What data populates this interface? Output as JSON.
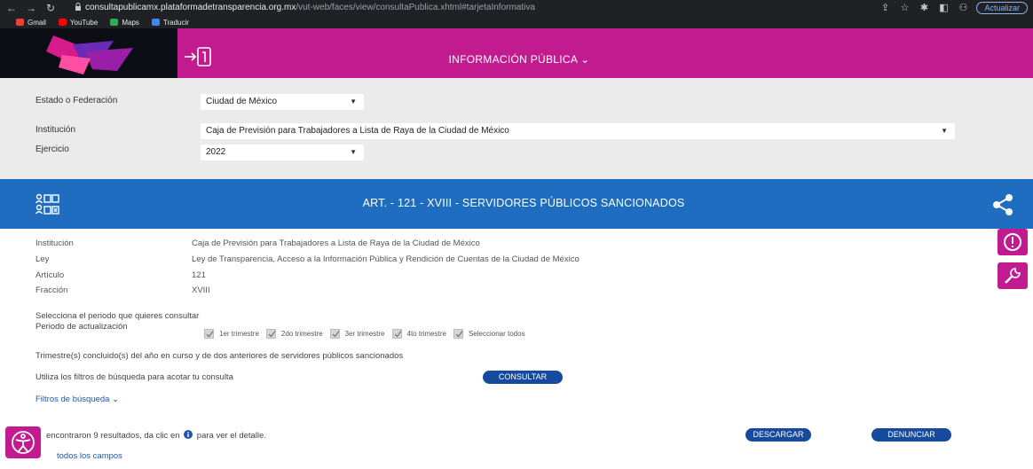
{
  "browser": {
    "url_host": "consultapublicamx.plataformadetransparencia.org.mx",
    "url_path": "/vut-web/faces/view/consultaPublica.xhtml#tarjetaInformativa",
    "update_label": "Actualizar",
    "bookmarks": [
      {
        "label": "Gmail",
        "color": "#ea4335"
      },
      {
        "label": "YouTube",
        "color": "#ff0000"
      },
      {
        "label": "Maps",
        "color": "#34a853"
      },
      {
        "label": "Traducir",
        "color": "#4285f4"
      }
    ]
  },
  "header": {
    "title": "INFORMACIÓN PÚBLICA",
    "accent_color": "#c21b8f"
  },
  "filters": {
    "state_label": "Estado o Federación",
    "state_value": "Ciudad de México",
    "institution_label": "Institución",
    "institution_value": "Caja de Previsión para Trabajadores a Lista de Raya de la Ciudad de México",
    "year_label": "Ejercicio",
    "year_value": "2022"
  },
  "article": {
    "title": "ART. - 121 - XVIII - SERVIDORES PÚBLICOS SANCIONADOS",
    "band_color": "#1f6dc0"
  },
  "info": {
    "institution_label": "Institución",
    "institution_value": "Caja de Previsión para Trabajadores a Lista de Raya de la Ciudad de México",
    "law_label": "Ley",
    "law_value": "Ley de Transparencia, Acceso a la Información Pública y Rendición de Cuentas de la Ciudad de México",
    "article_label": "Artículo",
    "article_value": "121",
    "fraction_label": "Fracción",
    "fraction_value": "XVIII"
  },
  "period": {
    "prompt": "Selecciona el periodo que quieres consultar",
    "label": "Periodo de actualización",
    "options": [
      {
        "label": "1er trimestre",
        "checked": true
      },
      {
        "label": "2do trimestre",
        "checked": true
      },
      {
        "label": "3er trimestre",
        "checked": true
      },
      {
        "label": "4to trimestre",
        "checked": true
      },
      {
        "label": "Seleccionar todos",
        "checked": true
      }
    ]
  },
  "description": "Trimestre(s) concluido(s) del año en curso y de dos anteriores de servidores públicos sancionados",
  "filter_hint": "Utiliza los filtros de búsqueda para acotar tu consulta",
  "consult_label": "CONSULTAR",
  "search_filters_label": "Filtros de búsqueda",
  "results": {
    "prefix": "encontraron 9 resultados, da clic en",
    "suffix": "para ver el detalle."
  },
  "download_label": "DESCARGAR",
  "report_label": "DENUNCIAR",
  "all_fields_label": "todos los campos"
}
